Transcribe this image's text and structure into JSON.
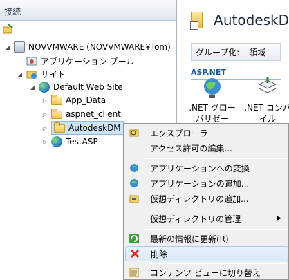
{
  "connections_pane": {
    "title": "接続"
  },
  "tree": {
    "server": "NOVVMWARE (NOVVMWARE¥Tom)",
    "app_pools": "アプリケーション プール",
    "sites": "サイト",
    "default_site": "Default Web Site",
    "children": [
      "App_Data",
      "aspnet_client",
      "AutodeskDM",
      "TestASP"
    ]
  },
  "content_pane": {
    "title": "AutodeskD",
    "group_by_label": "グループ化:",
    "group_by_value": "領域",
    "section": "ASP.NET",
    "features": [
      {
        "label_line1": ".NET グロー",
        "label_line2": "バリゼーシ..."
      },
      {
        "label_line1": ".NET コンパ",
        "label_line2": "イル"
      }
    ]
  },
  "context_menu": {
    "items": [
      {
        "label": "エクスプローラ",
        "icon": "explore-icon"
      },
      {
        "label": "アクセス許可の編集..."
      },
      {
        "label": "アプリケーションへの変換",
        "icon": "convert-app-icon"
      },
      {
        "label": "アプリケーションの追加...",
        "icon": "add-app-icon"
      },
      {
        "label": "仮想ディレクトリの追加...",
        "icon": "add-vdir-icon"
      },
      {
        "label": "仮想ディレクトリの管理"
      },
      {
        "label": "最新の情報に更新(R)",
        "icon": "refresh-icon"
      },
      {
        "label": "削除",
        "icon": "delete-icon"
      },
      {
        "label": "コンテンツ ビューに切り替え",
        "icon": "content-view-icon"
      }
    ]
  }
}
